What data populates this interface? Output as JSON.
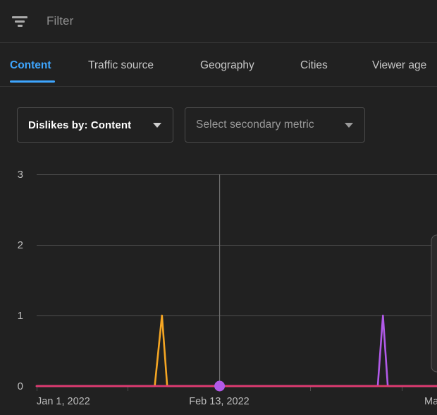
{
  "filter_bar": {
    "icon": "filter-funnel-icon",
    "placeholder": "Filter"
  },
  "tabs": [
    {
      "label": "Content",
      "active": true
    },
    {
      "label": "Traffic source",
      "active": false
    },
    {
      "label": "Geography",
      "active": false
    },
    {
      "label": "Cities",
      "active": false
    },
    {
      "label": "Viewer age",
      "active": false
    }
  ],
  "selectors": {
    "primary": {
      "label": "Dislikes by: Content",
      "icon": "chevron-down-icon"
    },
    "secondary": {
      "label": "Select secondary metric",
      "icon": "chevron-down-icon"
    }
  },
  "colors": {
    "accent_blue": "#3ea6ff",
    "background": "#212121",
    "series_crimson": "#e0386f",
    "series_orange": "#f5a623",
    "series_purple": "#b15ae8",
    "marker_purple": "#b15ae8",
    "gridline": "#4d4d4d"
  },
  "chart_data": {
    "type": "line",
    "title": "",
    "xlabel": "",
    "ylabel": "",
    "ylim": [
      0,
      3
    ],
    "yticks": [
      "0",
      "1",
      "2",
      "3"
    ],
    "xticks": [
      "Jan 1, 2022",
      "Feb 13, 2022",
      "Ma"
    ],
    "grid": true,
    "legend": "none",
    "hover_date": "Feb 13, 2022",
    "series": [
      {
        "name": "series-crimson",
        "color": "#e0386f",
        "values": [
          {
            "x": 0.0,
            "y": 0
          },
          {
            "x": 1.0,
            "y": 0
          }
        ]
      },
      {
        "name": "series-orange",
        "color": "#f5a623",
        "values": [
          {
            "x": 0.0,
            "y": 0
          },
          {
            "x": 0.295,
            "y": 0
          },
          {
            "x": 0.313,
            "y": 1
          },
          {
            "x": 0.326,
            "y": 0
          },
          {
            "x": 1.0,
            "y": 0
          }
        ]
      },
      {
        "name": "series-purple",
        "color": "#b15ae8",
        "values": [
          {
            "x": 0.0,
            "y": 0
          },
          {
            "x": 0.852,
            "y": 0
          },
          {
            "x": 0.865,
            "y": 1
          },
          {
            "x": 0.877,
            "y": 0
          },
          {
            "x": 1.0,
            "y": 0
          }
        ]
      }
    ],
    "markers": [
      {
        "name": "hover-marker",
        "x": 0.457,
        "y": 0,
        "color": "#b15ae8"
      }
    ],
    "cursor_line": {
      "x": 0.457
    }
  }
}
